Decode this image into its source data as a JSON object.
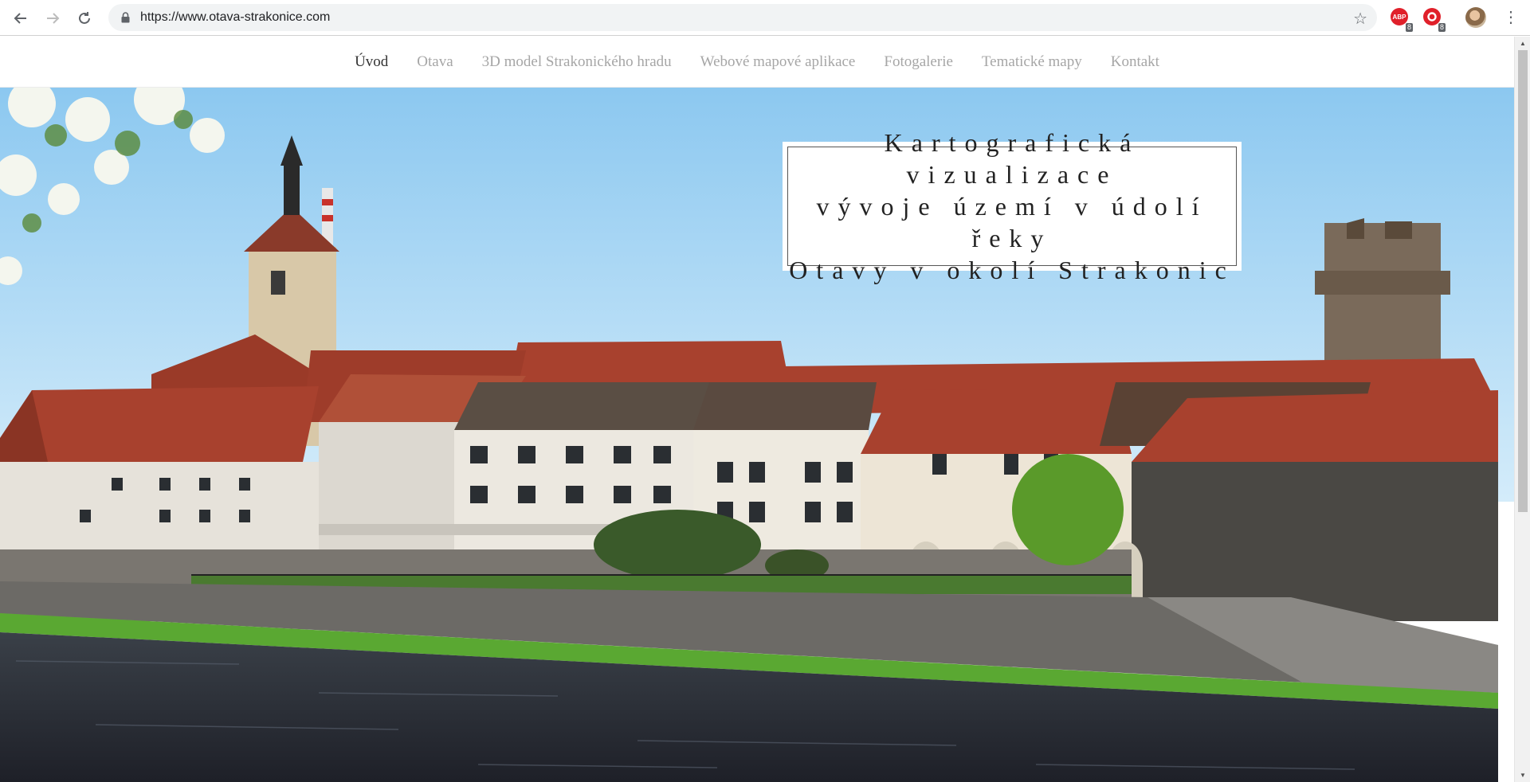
{
  "browser": {
    "url": "https://www.otava-strakonice.com",
    "extensions": [
      {
        "name": "adblock-plus",
        "label": "ABP",
        "badge": "8",
        "color": "#e0202a"
      },
      {
        "name": "opera-adblock",
        "label": "",
        "badge": "8",
        "color": "#e0202a"
      }
    ]
  },
  "site_nav": {
    "items": [
      {
        "label": "Úvod",
        "active": true
      },
      {
        "label": "Otava",
        "active": false
      },
      {
        "label": "3D model Strakonického hradu",
        "active": false
      },
      {
        "label": "Webové mapové aplikace",
        "active": false
      },
      {
        "label": "Fotogalerie",
        "active": false
      },
      {
        "label": "Tematické mapy",
        "active": false
      },
      {
        "label": "Kontakt",
        "active": false
      }
    ]
  },
  "hero": {
    "title_lines": [
      "Kartografická vizualizace",
      "vývoje území v údolí řeky",
      "Otavy v okolí Strakonic"
    ]
  },
  "colors": {
    "sky": "#a8d4f2",
    "roof": "#a8412e",
    "wall": "#e8e4dc",
    "grass": "#5aa832",
    "water": "#2a2e3a"
  }
}
